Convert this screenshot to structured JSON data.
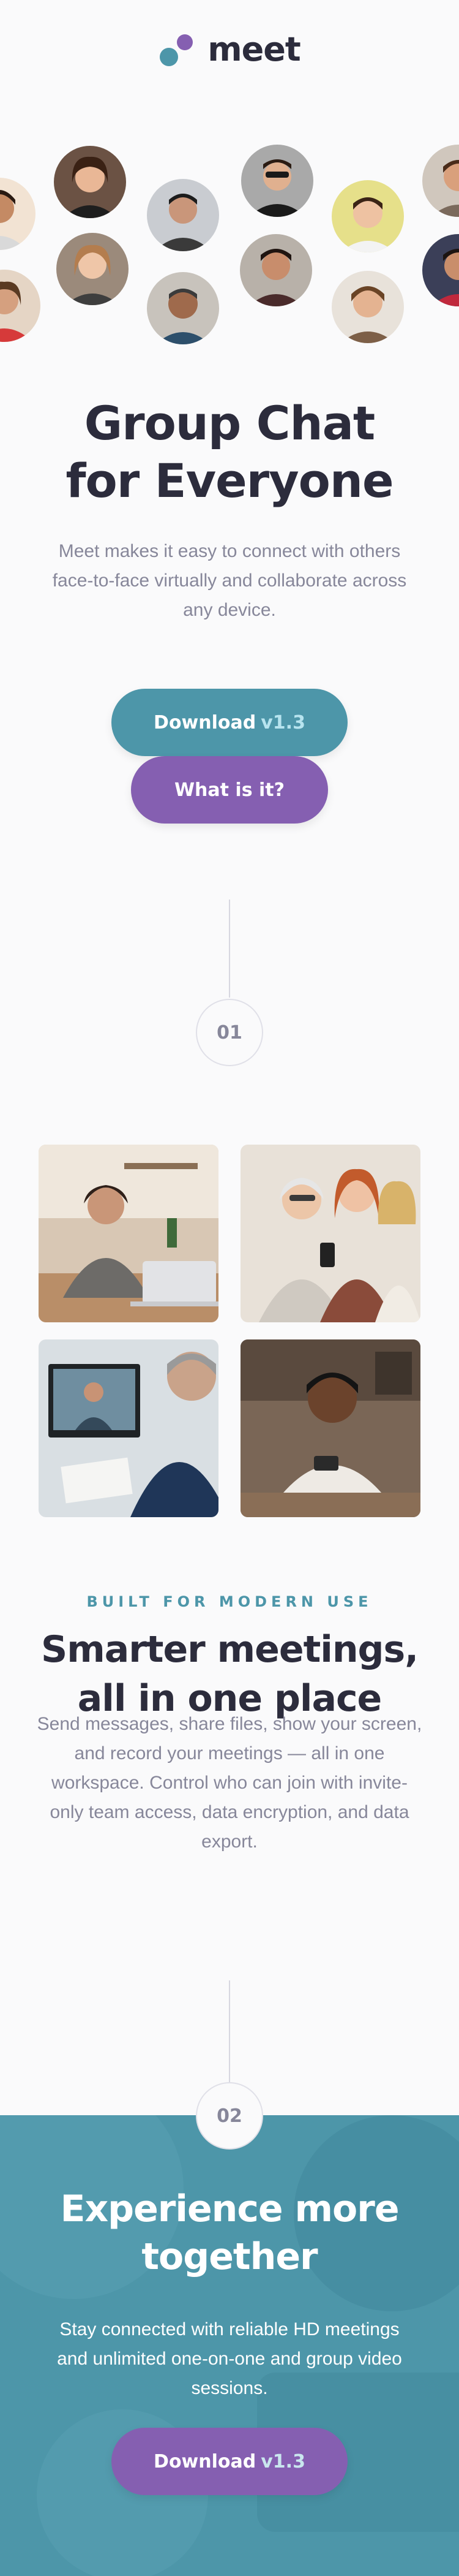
{
  "brand": {
    "name": "meet",
    "colors": {
      "teal": "#4D96A9",
      "purple": "#855FB1",
      "dark": "#2C2C3C",
      "gray": "#87879A"
    }
  },
  "hero": {
    "title_line1": "Group Chat",
    "title_line2": "for Everyone",
    "text": "Meet makes it easy to connect with others face-to-face virtually and collaborate across any device.",
    "download_label": "Download",
    "download_version": "v1.3",
    "what_label": "What is it?"
  },
  "steps": {
    "first": "01",
    "second": "02"
  },
  "features": {
    "eyebrow": "BUILT FOR MODERN USE",
    "title_line1": "Smarter meetings,",
    "title_line2": "all in one place",
    "text": "Send messages, share files, show your screen, and record your meetings — all in one workspace. Control who can join with invite-only team access, data encryption, and data export."
  },
  "cta": {
    "title_line1": "Experience more",
    "title_line2": "together",
    "text": "Stay connected with reliable HD meetings and unlimited one-on-one and group video sessions.",
    "download_label": "Download",
    "download_version": "v1.3"
  }
}
